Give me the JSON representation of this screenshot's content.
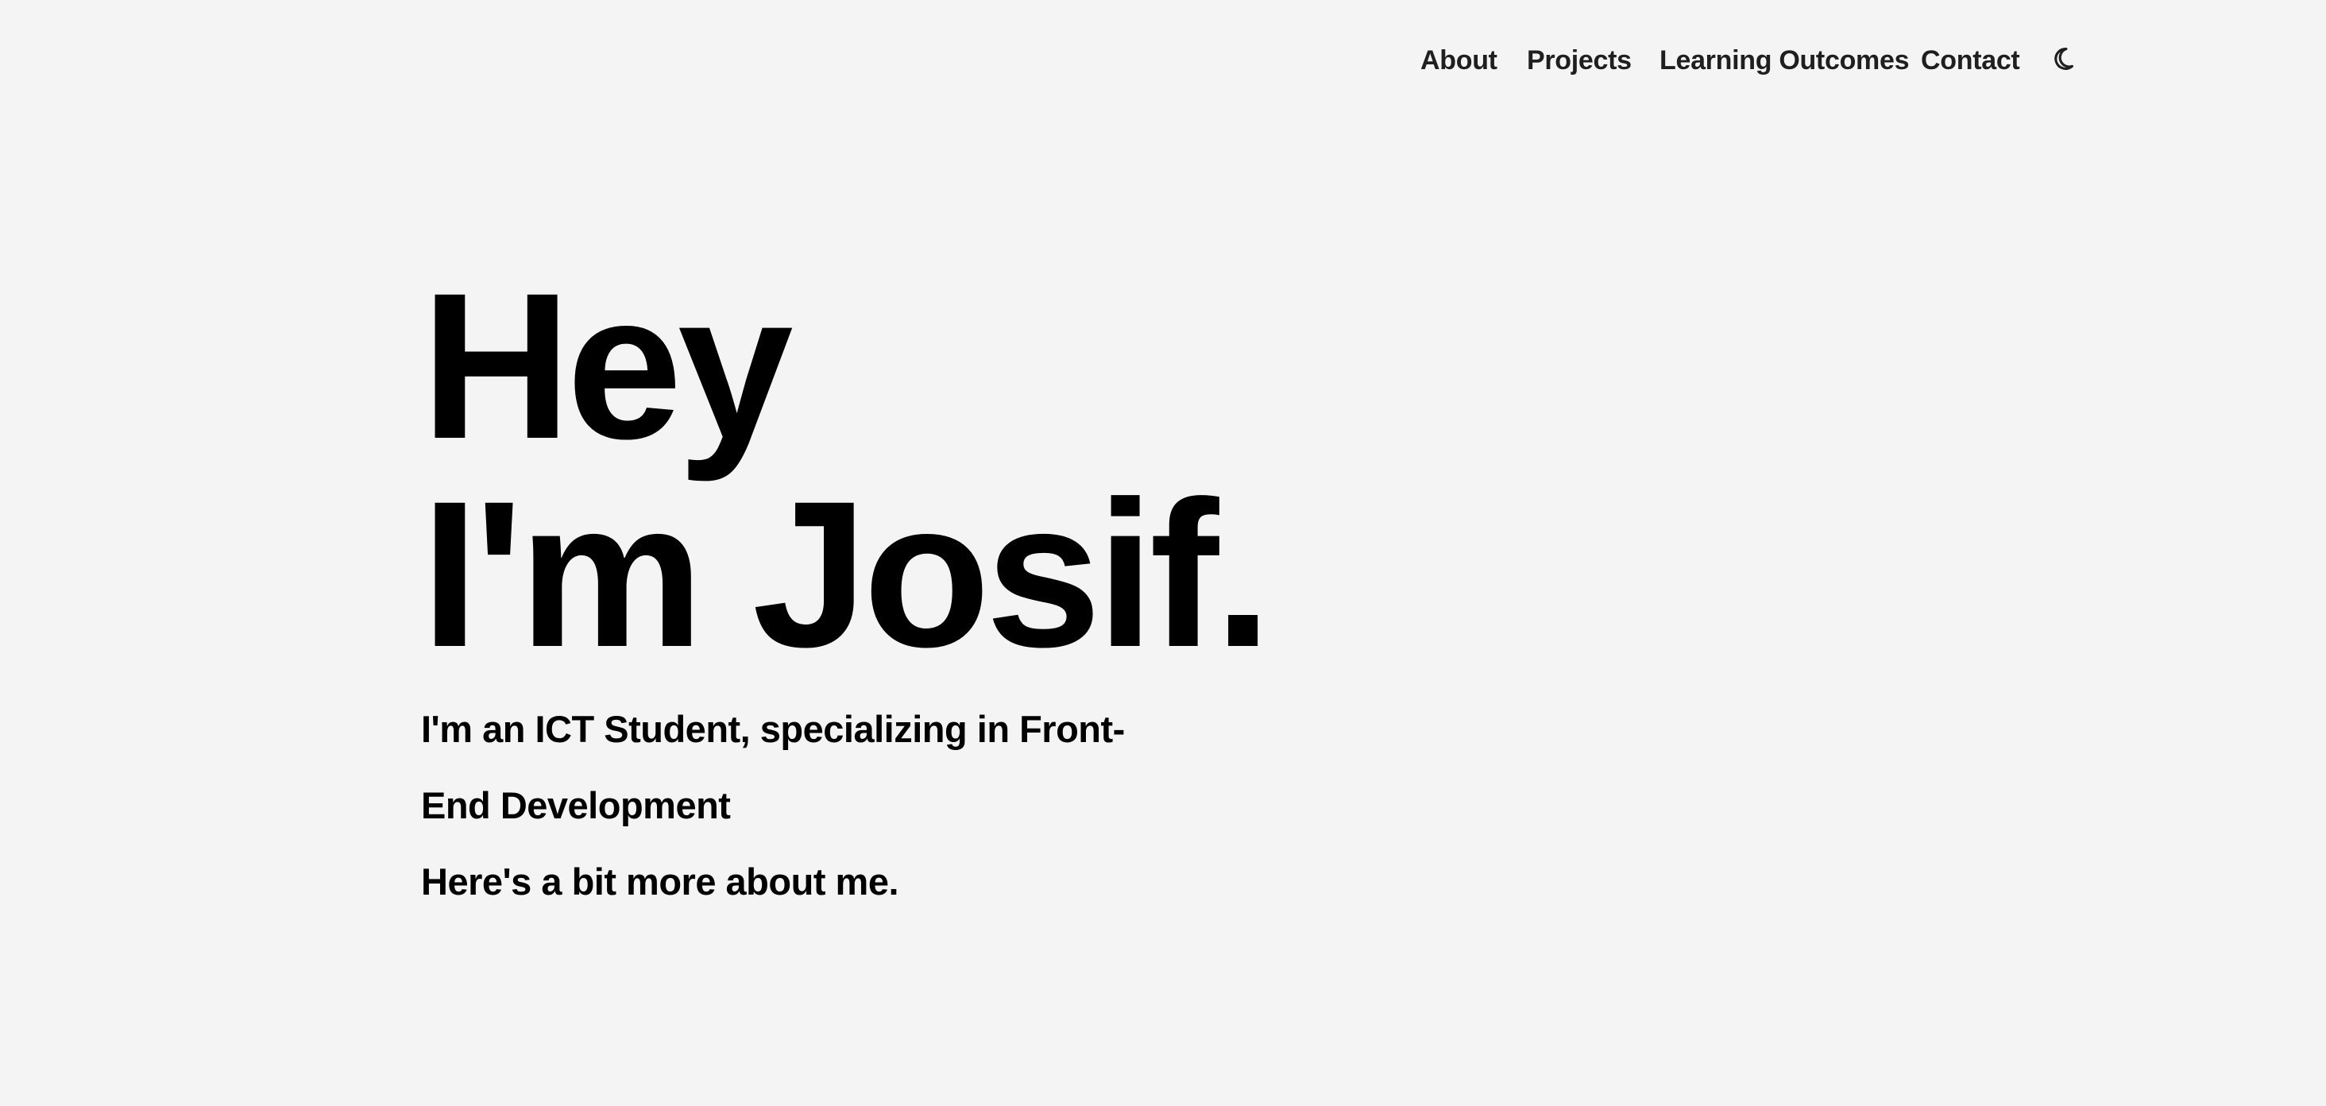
{
  "nav": {
    "items": [
      {
        "label": "About"
      },
      {
        "label": "Projects"
      },
      {
        "label": "Learning Outcomes"
      },
      {
        "label": "Contact"
      }
    ],
    "theme_toggle_icon": "moon-icon"
  },
  "hero": {
    "title_line_1": "Hey",
    "title_line_2": "I'm Josif.",
    "subtitle": "I'm an ICT Student, specializing in Front-End Development",
    "more": "Here's a bit more about me."
  },
  "colors": {
    "background": "#f4f4f4",
    "text": "#000000",
    "nav_text": "#1f1f1f"
  }
}
